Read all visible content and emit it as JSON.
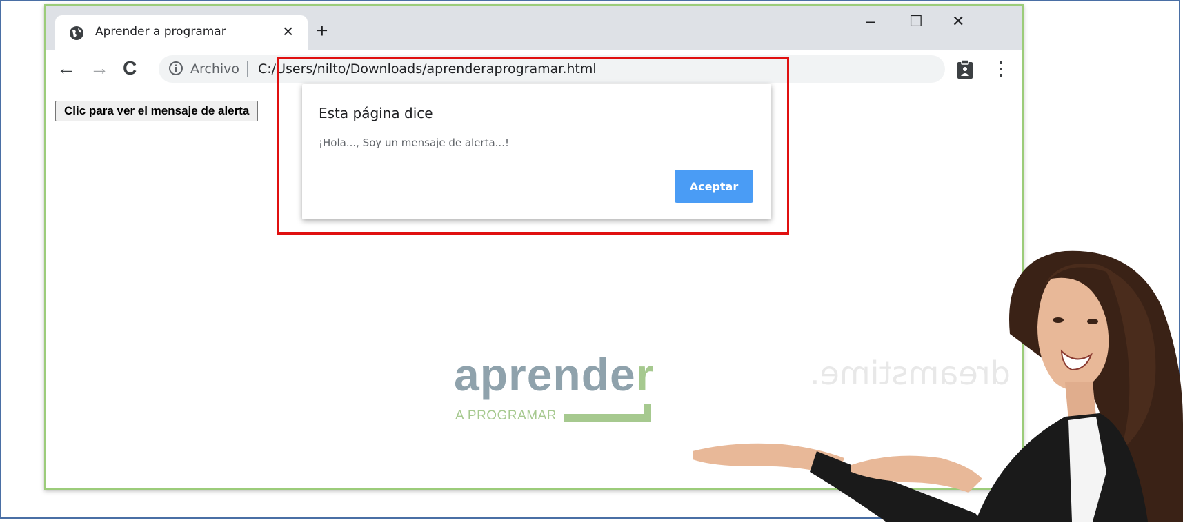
{
  "browser": {
    "tab_title": "Aprender a programar",
    "tab_close": "×",
    "new_tab": "+",
    "window_controls": {
      "minimize": "–",
      "maximize": "☐",
      "close": "✕"
    },
    "nav": {
      "back": "←",
      "forward": "→",
      "reload": "C"
    },
    "omnibox": {
      "security_label": "Archivo",
      "url": "C:/Users/nilto/Downloads/aprenderaprogramar.html"
    },
    "menu": "⋮"
  },
  "page": {
    "alert_button_label": "Clic para ver el mensaje de alerta"
  },
  "dialog": {
    "title": "Esta página dice",
    "message": "¡Hola..., Soy un mensaje de alerta...!",
    "ok_label": "Aceptar"
  },
  "logo": {
    "word_main": "aprende",
    "word_last": "r",
    "tagline": "A PROGRAMAR"
  },
  "overlay": {
    "watermark": "dreamstime."
  },
  "colors": {
    "highlight": "#e01010",
    "ok_button": "#4a9cf5",
    "window_border": "#9ccc7a",
    "logo_gray": "#8fa2ac",
    "logo_green": "#a6c98f"
  }
}
